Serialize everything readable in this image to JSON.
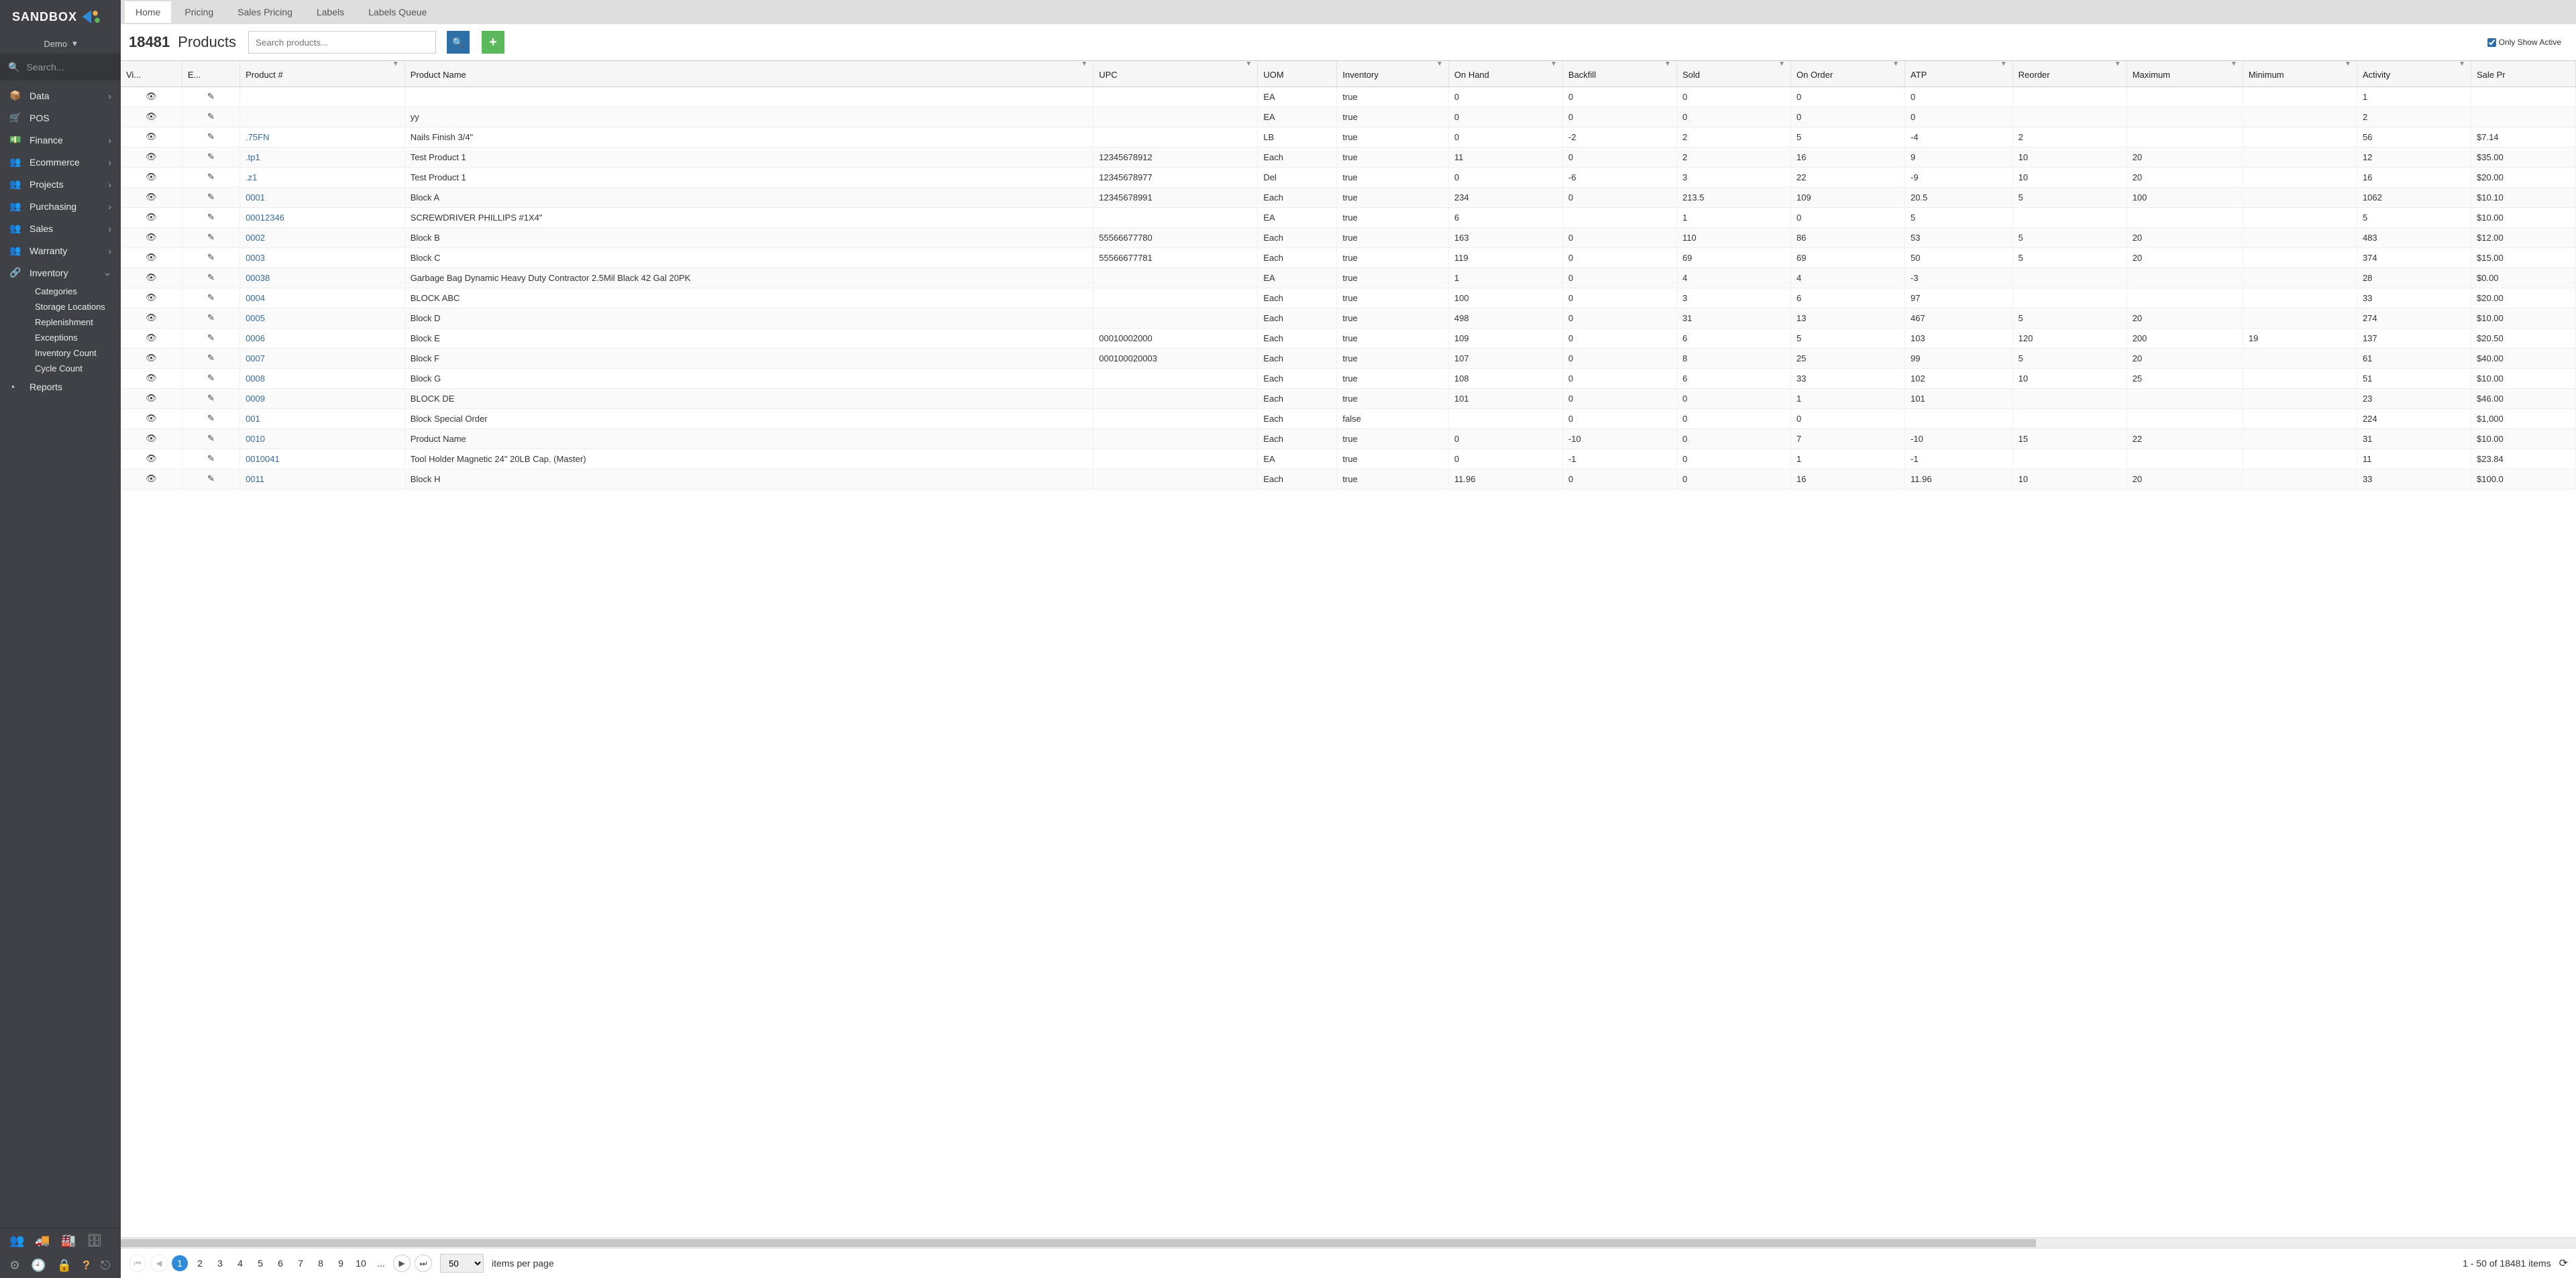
{
  "brand": "SANDBOX",
  "env": {
    "label": "Demo"
  },
  "sidebar": {
    "search_placeholder": "Search...",
    "items": [
      {
        "icon": "cube",
        "label": "Data",
        "expandable": true
      },
      {
        "icon": "cart",
        "label": "POS",
        "expandable": false
      },
      {
        "icon": "money",
        "label": "Finance",
        "expandable": true
      },
      {
        "icon": "users",
        "label": "Ecommerce",
        "expandable": true
      },
      {
        "icon": "users",
        "label": "Projects",
        "expandable": true
      },
      {
        "icon": "users",
        "label": "Purchasing",
        "expandable": true
      },
      {
        "icon": "users",
        "label": "Sales",
        "expandable": true
      },
      {
        "icon": "users",
        "label": "Warranty",
        "expandable": true
      },
      {
        "icon": "share",
        "label": "Inventory",
        "expandable": true,
        "expanded": true,
        "children": [
          "Categories",
          "Storage Locations",
          "Replenishment",
          "Exceptions",
          "Inventory Count",
          "Cycle Count"
        ]
      },
      {
        "icon": "pie",
        "label": "Reports",
        "expandable": false
      }
    ],
    "footer1": [
      "users-icon",
      "truck-icon",
      "factory-icon",
      "archive-icon"
    ],
    "footer2": [
      "gear-icon",
      "clock-icon",
      "lock-icon",
      "help-icon",
      "logout-icon"
    ]
  },
  "tabs": [
    "Home",
    "Pricing",
    "Sales Pricing",
    "Labels",
    "Labels Queue"
  ],
  "active_tab": 0,
  "page": {
    "count": "18481",
    "title": "Products",
    "search_placeholder": "Search products...",
    "only_active_label": "Only Show Active",
    "only_active_checked": true
  },
  "columns": [
    {
      "key": "vi",
      "label": "Vi...",
      "filter": false,
      "cls": "col-vi"
    },
    {
      "key": "ed",
      "label": "E...",
      "filter": false,
      "cls": "col-ed"
    },
    {
      "key": "prodnum",
      "label": "Product #",
      "filter": true,
      "cls": "col-prodnum"
    },
    {
      "key": "prodname",
      "label": "Product Name",
      "filter": true,
      "cls": "col-prodname"
    },
    {
      "key": "upc",
      "label": "UPC",
      "filter": true,
      "cls": "col-upc"
    },
    {
      "key": "uom",
      "label": "UOM",
      "filter": false,
      "cls": "col-uom"
    },
    {
      "key": "inv",
      "label": "Inventory",
      "filter": true,
      "cls": "col-inv"
    },
    {
      "key": "oh",
      "label": "On Hand",
      "filter": true,
      "cls": "col-oh"
    },
    {
      "key": "bf",
      "label": "Backfill",
      "filter": true,
      "cls": "col-bf"
    },
    {
      "key": "sold",
      "label": "Sold",
      "filter": true,
      "cls": "col-sold"
    },
    {
      "key": "oo",
      "label": "On Order",
      "filter": true,
      "cls": "col-oo"
    },
    {
      "key": "atp",
      "label": "ATP",
      "filter": true,
      "cls": "col-atp"
    },
    {
      "key": "re",
      "label": "Reorder",
      "filter": true,
      "cls": "col-re"
    },
    {
      "key": "max",
      "label": "Maximum",
      "filter": true,
      "cls": "col-max"
    },
    {
      "key": "min",
      "label": "Minimum",
      "filter": true,
      "cls": "col-min"
    },
    {
      "key": "act",
      "label": "Activity",
      "filter": true,
      "cls": "col-act"
    },
    {
      "key": "sp",
      "label": "Sale Pr",
      "filter": false,
      "cls": "col-sp"
    }
  ],
  "rows": [
    {
      "prodnum": "",
      "prodname": "",
      "upc": "",
      "uom": "EA",
      "inv": "true",
      "oh": "0",
      "bf": "0",
      "sold": "0",
      "oo": "0",
      "atp": "0",
      "re": "",
      "max": "",
      "min": "",
      "act": "1",
      "sp": ""
    },
    {
      "prodnum": "",
      "prodname": "yy",
      "upc": "",
      "uom": "EA",
      "inv": "true",
      "oh": "0",
      "bf": "0",
      "sold": "0",
      "oo": "0",
      "atp": "0",
      "re": "",
      "max": "",
      "min": "",
      "act": "2",
      "sp": ""
    },
    {
      "prodnum": ".75FN",
      "prodname": "Nails Finish 3/4\"",
      "upc": "",
      "uom": "LB",
      "inv": "true",
      "oh": "0",
      "bf": "-2",
      "sold": "2",
      "oo": "5",
      "atp": "-4",
      "re": "2",
      "max": "",
      "min": "",
      "act": "56",
      "sp": "$7.14"
    },
    {
      "prodnum": ".tp1",
      "prodname": "Test Product 1",
      "upc": "12345678912",
      "uom": "Each",
      "inv": "true",
      "oh": "11",
      "bf": "0",
      "sold": "2",
      "oo": "16",
      "atp": "9",
      "re": "10",
      "max": "20",
      "min": "",
      "act": "12",
      "sp": "$35.00"
    },
    {
      "prodnum": ".z1",
      "prodname": "Test Product 1",
      "upc": "12345678977",
      "uom": "Del",
      "inv": "true",
      "oh": "0",
      "bf": "-6",
      "sold": "3",
      "oo": "22",
      "atp": "-9",
      "re": "10",
      "max": "20",
      "min": "",
      "act": "16",
      "sp": "$20.00"
    },
    {
      "prodnum": "0001",
      "prodname": "Block A",
      "upc": "12345678991",
      "uom": "Each",
      "inv": "true",
      "oh": "234",
      "bf": "0",
      "sold": "213.5",
      "oo": "109",
      "atp": "20.5",
      "re": "5",
      "max": "100",
      "min": "",
      "act": "1062",
      "sp": "$10.10"
    },
    {
      "prodnum": "00012346",
      "prodname": "SCREWDRIVER PHILLIPS #1X4\"",
      "upc": "",
      "uom": "EA",
      "inv": "true",
      "oh": "6",
      "bf": "",
      "sold": "1",
      "oo": "0",
      "atp": "5",
      "re": "",
      "max": "",
      "min": "",
      "act": "5",
      "sp": "$10.00"
    },
    {
      "prodnum": "0002",
      "prodname": "Block B",
      "upc": "55566677780",
      "uom": "Each",
      "inv": "true",
      "oh": "163",
      "bf": "0",
      "sold": "110",
      "oo": "86",
      "atp": "53",
      "re": "5",
      "max": "20",
      "min": "",
      "act": "483",
      "sp": "$12.00"
    },
    {
      "prodnum": "0003",
      "prodname": "Block C",
      "upc": "55566677781",
      "uom": "Each",
      "inv": "true",
      "oh": "119",
      "bf": "0",
      "sold": "69",
      "oo": "69",
      "atp": "50",
      "re": "5",
      "max": "20",
      "min": "",
      "act": "374",
      "sp": "$15.00"
    },
    {
      "prodnum": "00038",
      "prodname": "Garbage Bag Dynamic Heavy Duty Contractor 2.5Mil Black 42 Gal 20PK",
      "upc": "",
      "uom": "EA",
      "inv": "true",
      "oh": "1",
      "bf": "0",
      "sold": "4",
      "oo": "4",
      "atp": "-3",
      "re": "",
      "max": "",
      "min": "",
      "act": "28",
      "sp": "$0.00"
    },
    {
      "prodnum": "0004",
      "prodname": "BLOCK ABC",
      "upc": "",
      "uom": "Each",
      "inv": "true",
      "oh": "100",
      "bf": "0",
      "sold": "3",
      "oo": "6",
      "atp": "97",
      "re": "",
      "max": "",
      "min": "",
      "act": "33",
      "sp": "$20.00"
    },
    {
      "prodnum": "0005",
      "prodname": "Block D",
      "upc": "",
      "uom": "Each",
      "inv": "true",
      "oh": "498",
      "bf": "0",
      "sold": "31",
      "oo": "13",
      "atp": "467",
      "re": "5",
      "max": "20",
      "min": "",
      "act": "274",
      "sp": "$10.00"
    },
    {
      "prodnum": "0006",
      "prodname": "Block E",
      "upc": "00010002000",
      "uom": "Each",
      "inv": "true",
      "oh": "109",
      "bf": "0",
      "sold": "6",
      "oo": "5",
      "atp": "103",
      "re": "120",
      "max": "200",
      "min": "19",
      "act": "137",
      "sp": "$20.50"
    },
    {
      "prodnum": "0007",
      "prodname": "Block F",
      "upc": "000100020003",
      "uom": "Each",
      "inv": "true",
      "oh": "107",
      "bf": "0",
      "sold": "8",
      "oo": "25",
      "atp": "99",
      "re": "5",
      "max": "20",
      "min": "",
      "act": "61",
      "sp": "$40.00"
    },
    {
      "prodnum": "0008",
      "prodname": "Block G",
      "upc": "",
      "uom": "Each",
      "inv": "true",
      "oh": "108",
      "bf": "0",
      "sold": "6",
      "oo": "33",
      "atp": "102",
      "re": "10",
      "max": "25",
      "min": "",
      "act": "51",
      "sp": "$10.00"
    },
    {
      "prodnum": "0009",
      "prodname": "BLOCK DE",
      "upc": "",
      "uom": "Each",
      "inv": "true",
      "oh": "101",
      "bf": "0",
      "sold": "0",
      "oo": "1",
      "atp": "101",
      "re": "",
      "max": "",
      "min": "",
      "act": "23",
      "sp": "$46.00"
    },
    {
      "prodnum": "001",
      "prodname": "Block Special Order",
      "upc": "",
      "uom": "Each",
      "inv": "false",
      "oh": "",
      "bf": "0",
      "sold": "0",
      "oo": "0",
      "atp": "",
      "re": "",
      "max": "",
      "min": "",
      "act": "224",
      "sp": "$1,000"
    },
    {
      "prodnum": "0010",
      "prodname": "Product Name",
      "upc": "",
      "uom": "Each",
      "inv": "true",
      "oh": "0",
      "bf": "-10",
      "sold": "0",
      "oo": "7",
      "atp": "-10",
      "re": "15",
      "max": "22",
      "min": "",
      "act": "31",
      "sp": "$10.00"
    },
    {
      "prodnum": "0010041",
      "prodname": "Tool Holder Magnetic 24\" 20LB Cap. (Master)",
      "upc": "",
      "uom": "EA",
      "inv": "true",
      "oh": "0",
      "bf": "-1",
      "sold": "0",
      "oo": "1",
      "atp": "-1",
      "re": "",
      "max": "",
      "min": "",
      "act": "11",
      "sp": "$23.84"
    },
    {
      "prodnum": "0011",
      "prodname": "Block H",
      "upc": "",
      "uom": "Each",
      "inv": "true",
      "oh": "11.96",
      "bf": "0",
      "sold": "0",
      "oo": "16",
      "atp": "11.96",
      "re": "10",
      "max": "20",
      "min": "",
      "act": "33",
      "sp": "$100.0"
    }
  ],
  "pager": {
    "pages": [
      "1",
      "2",
      "3",
      "4",
      "5",
      "6",
      "7",
      "8",
      "9",
      "10",
      "..."
    ],
    "current": 0,
    "page_size": "50",
    "items_per_page": "items per page",
    "summary": "1 - 50 of 18481 items"
  }
}
